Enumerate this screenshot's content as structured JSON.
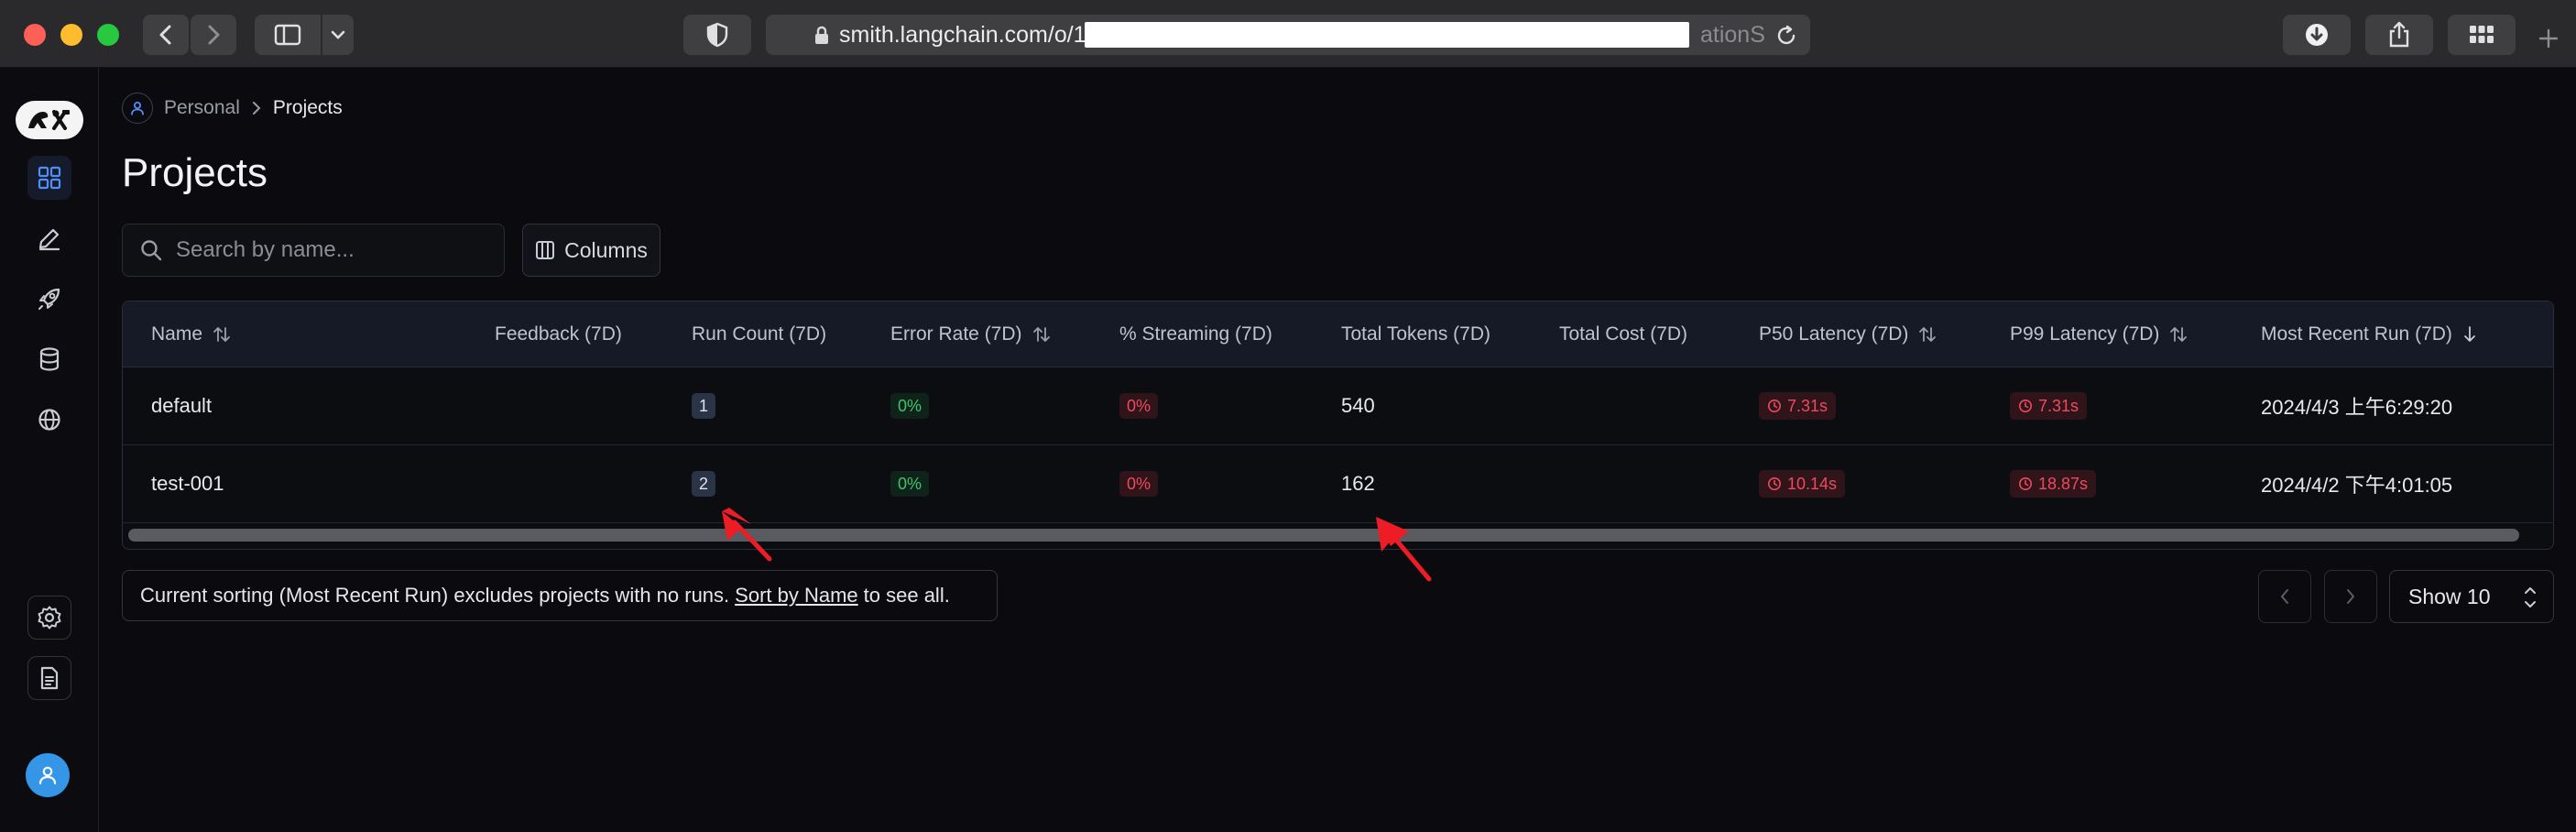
{
  "browser": {
    "url_prefix": "smith.langchain.com/o/1",
    "url_suffix": "ationS"
  },
  "breadcrumb": {
    "parent": "Personal",
    "current": "Projects"
  },
  "page": {
    "title": "Projects"
  },
  "toolbar": {
    "search_placeholder": "Search by name...",
    "columns_label": "Columns"
  },
  "table": {
    "headers": {
      "name": "Name",
      "feedback": "Feedback (7D)",
      "run_count": "Run Count (7D)",
      "error_rate": "Error Rate (7D)",
      "streaming": "% Streaming (7D)",
      "total_tokens": "Total Tokens (7D)",
      "total_cost": "Total Cost (7D)",
      "p50": "P50 Latency (7D)",
      "p99": "P99 Latency (7D)",
      "most_recent": "Most Recent Run (7D)"
    },
    "rows": [
      {
        "name": "default",
        "feedback": "",
        "run_count": "1",
        "error_rate": "0%",
        "streaming": "0%",
        "total_tokens": "540",
        "total_cost": "",
        "p50": "7.31s",
        "p99": "7.31s",
        "most_recent": "2024/4/3 上午6:29:20"
      },
      {
        "name": "test-001",
        "feedback": "",
        "run_count": "2",
        "error_rate": "0%",
        "streaming": "0%",
        "total_tokens": "162",
        "total_cost": "",
        "p50": "10.14s",
        "p99": "18.87s",
        "most_recent": "2024/4/2 下午4:01:05"
      }
    ]
  },
  "footer": {
    "notice_prefix": "Current sorting (Most Recent Run) excludes projects with no runs.",
    "notice_link": "Sort by Name",
    "notice_suffix": "to see all.",
    "page_size": "Show 10"
  },
  "colors": {
    "accent": "#3b82f6",
    "ok": "#3fc46e",
    "error": "#ef4960",
    "annotation": "#ee1d25"
  },
  "icons": {
    "sidebar": [
      "projects-grid-icon",
      "pencil-icon",
      "rocket-icon",
      "database-icon",
      "globe-icon",
      "settings-icon",
      "document-icon",
      "user-icon"
    ]
  }
}
